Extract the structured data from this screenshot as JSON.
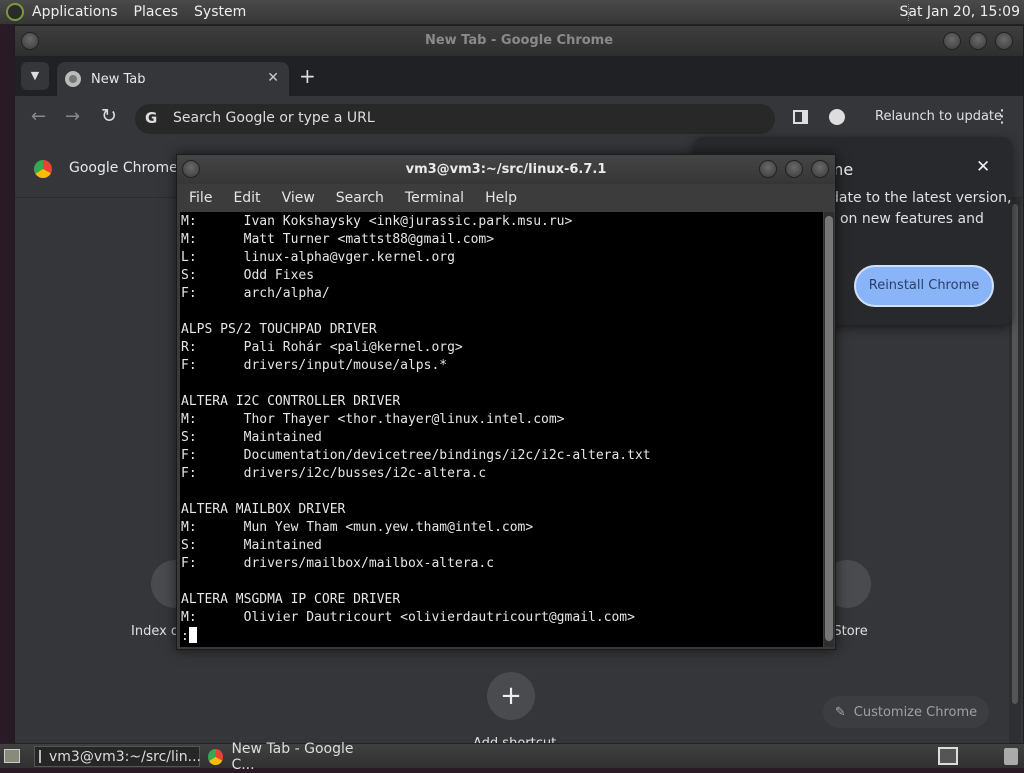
{
  "top_panel": {
    "menus": [
      "Applications",
      "Places",
      "System"
    ],
    "clock": "Sat Jan 20, 15:09"
  },
  "chrome": {
    "window_title": "New Tab - Google Chrome",
    "tab_title": "New Tab",
    "omnibox_placeholder": "Search Google or type a URL",
    "relaunch_label": "Relaunch to update",
    "infobar_text": "Google Chrome is",
    "popup": {
      "title_fragment": "ome",
      "body_line1": "date to the latest version,",
      "body_line2": "t on new features and",
      "reinstall_label": "Reinstall Chrome"
    },
    "shortcuts": {
      "left_label": "Index of",
      "right_label": "b Store",
      "add_label": "Add shortcut"
    },
    "customize_label": "Customize Chrome"
  },
  "terminal": {
    "title": "vm3@vm3:~/src/linux-6.7.1",
    "menu": [
      "File",
      "Edit",
      "View",
      "Search",
      "Terminal",
      "Help"
    ],
    "lines": [
      "M:      Ivan Kokshaysky <ink@jurassic.park.msu.ru>",
      "M:      Matt Turner <mattst88@gmail.com>",
      "L:      linux-alpha@vger.kernel.org",
      "S:      Odd Fixes",
      "F:      arch/alpha/",
      "",
      "ALPS PS/2 TOUCHPAD DRIVER",
      "R:      Pali Rohár <pali@kernel.org>",
      "F:      drivers/input/mouse/alps.*",
      "",
      "ALTERA I2C CONTROLLER DRIVER",
      "M:      Thor Thayer <thor.thayer@linux.intel.com>",
      "S:      Maintained",
      "F:      Documentation/devicetree/bindings/i2c/i2c-altera.txt",
      "F:      drivers/i2c/busses/i2c-altera.c",
      "",
      "ALTERA MAILBOX DRIVER",
      "M:      Mun Yew Tham <mun.yew.tham@intel.com>",
      "S:      Maintained",
      "F:      drivers/mailbox/mailbox-altera.c",
      "",
      "ALTERA MSGDMA IP CORE DRIVER",
      "M:      Olivier Dautricourt <olivierdautricourt@gmail.com>"
    ],
    "prompt": ":"
  },
  "taskbar": {
    "items": [
      "vm3@vm3:~/src/lin...",
      "New Tab - Google C..."
    ]
  }
}
